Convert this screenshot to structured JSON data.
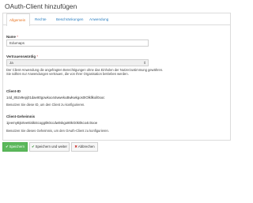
{
  "page": {
    "title": "OAuth-Client hinzufügen"
  },
  "tabs": [
    {
      "label": "Allgemein",
      "active": true
    },
    {
      "label": "Rechte",
      "active": false
    },
    {
      "label": "Beschränkungen",
      "active": false
    },
    {
      "label": "Anwendung",
      "active": false
    }
  ],
  "form": {
    "name": {
      "label": "Name",
      "required_mark": "*",
      "value": "Edumaps"
    },
    "trusted": {
      "label": "Vertrauenswürdig",
      "required_mark": "*",
      "value": "Ja",
      "help": "Der Client-Anwendung die angefragten Berechtigungen ohne das Einholen der Nutzerzustimmung gewähren. Sie sollten nur Anwendungen vertrauen, die von Ihrer Organisation betrieben werden."
    },
    "client_id": {
      "label": "Client-ID",
      "value": "14d_852v9epj01dae80gowkoo44wwekuBwkwkgos0IOlkllkoil0ooc",
      "help": "Benutzen Sie diese ID, um den Client zu konfigurieren."
    },
    "client_secret": {
      "label": "Client-Geheimnis",
      "value": "1jeemyBjsrtee8i4ikt4cogg0k0ccdw0skgo80kG0k0kco4c0ooe",
      "help": "Benutzen Sie dieses Geheimnis, um den OAuth-Client zu konfigurieren."
    }
  },
  "buttons": {
    "save": "Speichern",
    "save_and_continue": "Speichern und weiter",
    "cancel": "Abbrechen"
  },
  "colors": {
    "accent": "#e8731f",
    "link": "#2a7ec0",
    "primary": "#5cb85c"
  }
}
